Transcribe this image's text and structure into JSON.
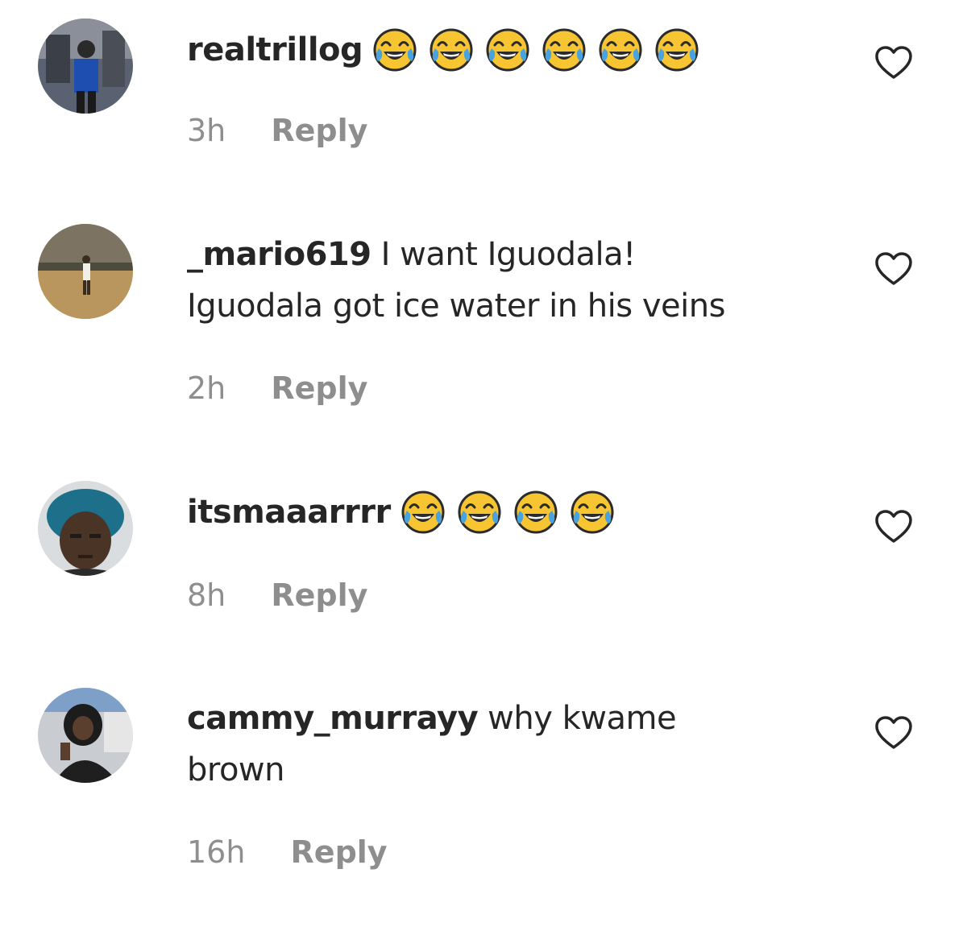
{
  "comments": [
    {
      "username": "realtrillog",
      "text": "",
      "text_line2": "",
      "emoji_count": 6,
      "emoji": "face-with-tears-of-joy",
      "time": "3h",
      "reply_label": "Reply"
    },
    {
      "username": "_mario619",
      "text": "I want Iguodala!",
      "text_line2": "Iguodala got ice water in his veins",
      "emoji_count": 0,
      "emoji": "",
      "time": "2h",
      "reply_label": "Reply"
    },
    {
      "username": "itsmaaarrrr",
      "text": "",
      "text_line2": "",
      "emoji_count": 4,
      "emoji": "face-with-tears-of-joy",
      "time": "8h",
      "reply_label": "Reply"
    },
    {
      "username": "cammy_murrayy",
      "text": "why kwame",
      "text_line2": "brown",
      "emoji_count": 0,
      "emoji": "",
      "time": "16h",
      "reply_label": "Reply"
    }
  ],
  "icons": {
    "like": "heart-outline-icon",
    "emoji": "face-with-tears-of-joy-icon"
  },
  "colors": {
    "text_primary": "#262626",
    "text_secondary": "#8e8e8e",
    "emoji_face": "#f7c531",
    "emoji_tears": "#4aa3df"
  }
}
